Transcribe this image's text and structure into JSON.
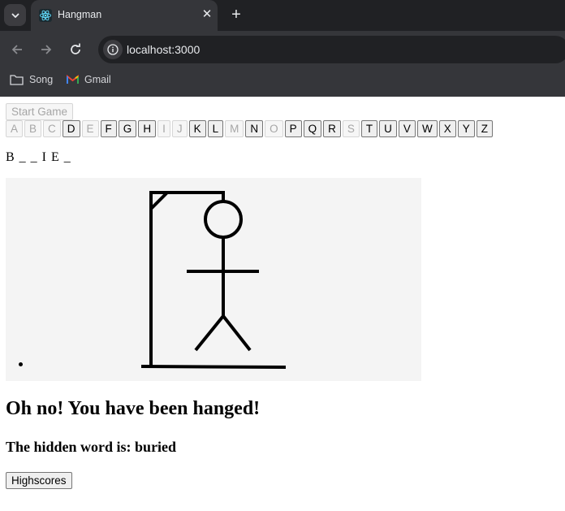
{
  "browser": {
    "tab_title": "Hangman",
    "url": "localhost:3000",
    "bookmarks": [
      {
        "label": "Song",
        "icon": "folder-icon"
      },
      {
        "label": "Gmail",
        "icon": "gmail-icon"
      }
    ],
    "colors": {
      "tabstrip": "#202124",
      "toolbar": "#35363a"
    }
  },
  "game": {
    "start_button_label": "Start Game",
    "start_button_disabled": true,
    "letters": [
      {
        "char": "A",
        "disabled": true
      },
      {
        "char": "B",
        "disabled": true
      },
      {
        "char": "C",
        "disabled": true
      },
      {
        "char": "D",
        "disabled": false
      },
      {
        "char": "E",
        "disabled": true
      },
      {
        "char": "F",
        "disabled": false
      },
      {
        "char": "G",
        "disabled": false
      },
      {
        "char": "H",
        "disabled": false
      },
      {
        "char": "I",
        "disabled": true
      },
      {
        "char": "J",
        "disabled": true
      },
      {
        "char": "K",
        "disabled": false
      },
      {
        "char": "L",
        "disabled": false
      },
      {
        "char": "M",
        "disabled": true
      },
      {
        "char": "N",
        "disabled": false
      },
      {
        "char": "O",
        "disabled": true
      },
      {
        "char": "P",
        "disabled": false
      },
      {
        "char": "Q",
        "disabled": false
      },
      {
        "char": "R",
        "disabled": false
      },
      {
        "char": "S",
        "disabled": true
      },
      {
        "char": "T",
        "disabled": false
      },
      {
        "char": "U",
        "disabled": false
      },
      {
        "char": "V",
        "disabled": false
      },
      {
        "char": "W",
        "disabled": false
      },
      {
        "char": "X",
        "disabled": false
      },
      {
        "char": "Y",
        "disabled": false
      },
      {
        "char": "Z",
        "disabled": false
      }
    ],
    "masked_word": "B _ _ I E _",
    "result_heading": "Oh no! You have been hanged!",
    "hidden_word_prefix": "The hidden word is: ",
    "hidden_word": "buried",
    "highscores_label": "Highscores"
  }
}
